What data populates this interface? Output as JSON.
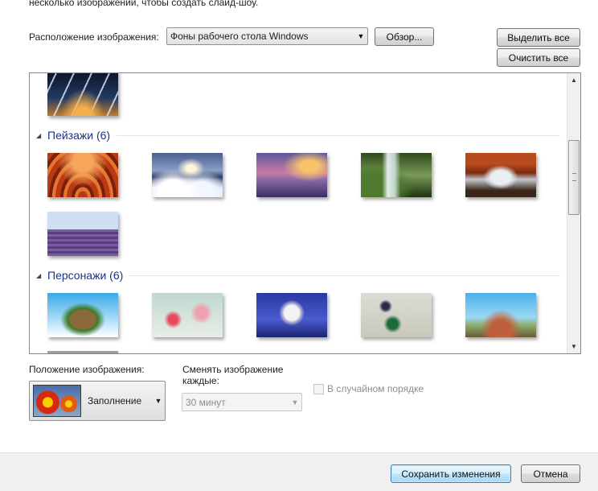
{
  "hint": "несколько изображений, чтобы создать слайд-шоу.",
  "location": {
    "label": "Расположение изображения:",
    "value": "Фоны рабочего стола Windows",
    "browse_label": "Обзор..."
  },
  "select_all_label": "Выделить все",
  "clear_all_label": "Очистить все",
  "groups": [
    {
      "title": "Пейзажи (6)"
    },
    {
      "title": "Персонажи (6)"
    }
  ],
  "position": {
    "label": "Положение изображения:",
    "value": "Заполнение"
  },
  "interval": {
    "label": "Сменять изображение каждые:",
    "value": "30 минут"
  },
  "shuffle_label": "В случайном порядке",
  "footer": {
    "save_label": "Сохранить изменения",
    "cancel_label": "Отмена"
  }
}
